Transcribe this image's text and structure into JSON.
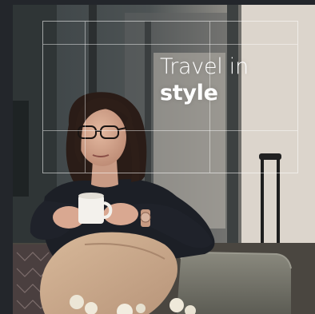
{
  "hero": {
    "headline_line1": "Travel in",
    "headline_line2": "style",
    "photo_subject": "woman-with-coffee-cup-in-lounge"
  },
  "colors": {
    "page_background": "#23262b",
    "frame_lines": "#ffffff",
    "headline_text": "#ffffff",
    "sofa": "#7d7c72",
    "trousers": "#c9a98a",
    "blouse": "#1c1f26"
  }
}
